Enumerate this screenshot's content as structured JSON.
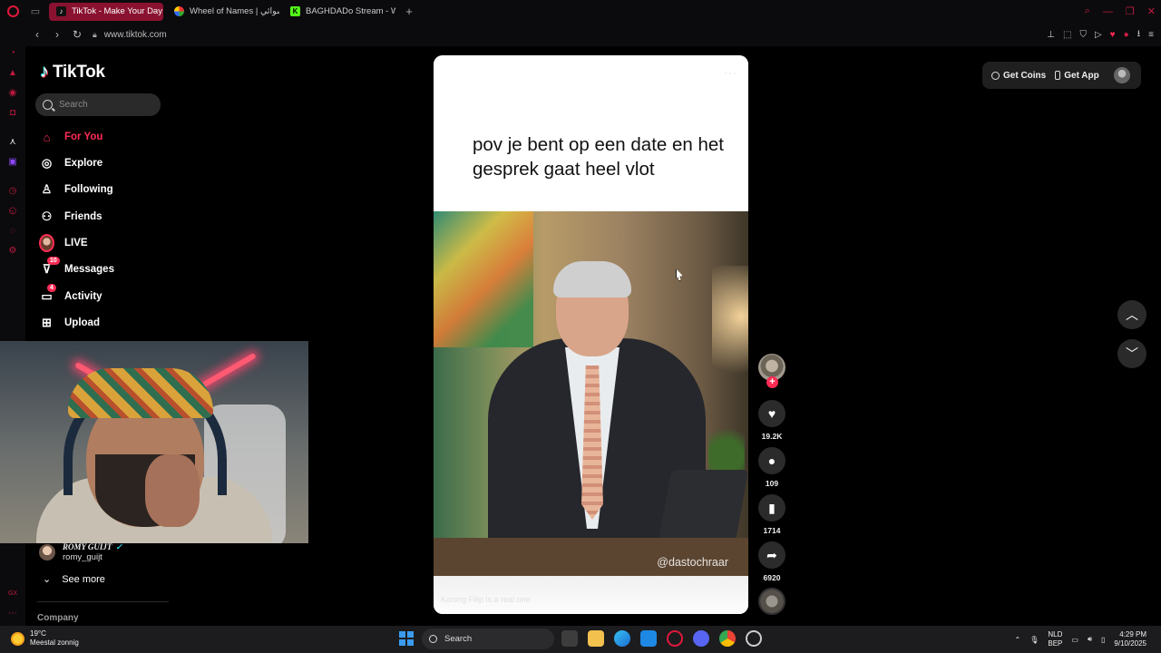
{
  "browser": {
    "tabs": [
      {
        "label": "TikTok - Make Your Day",
        "active": true,
        "icon": "tiktok-icon"
      },
      {
        "label": "Wheel of Names | عشوائي",
        "active": false,
        "icon": "wheel-icon"
      },
      {
        "label": "BAGHDADo Stream - Wat",
        "active": false,
        "icon": "kick-icon"
      }
    ],
    "url": "www.tiktok.com"
  },
  "tiktok": {
    "logo_text": "TikTok",
    "search_placeholder": "Search",
    "nav": [
      {
        "label": "For You",
        "icon": "home-icon",
        "active": true
      },
      {
        "label": "Explore",
        "icon": "compass-icon"
      },
      {
        "label": "Following",
        "icon": "following-icon"
      },
      {
        "label": "Friends",
        "icon": "friends-icon"
      },
      {
        "label": "LIVE",
        "icon": "live-avatar"
      },
      {
        "label": "Messages",
        "icon": "messages-icon",
        "badge": "10"
      },
      {
        "label": "Activity",
        "icon": "activity-icon",
        "badge": "4"
      },
      {
        "label": "Upload",
        "icon": "upload-icon"
      }
    ],
    "following_account": {
      "display_name": "ROMY GUIJT",
      "username": "romy_guijt"
    },
    "see_more": "See more",
    "company": "Company",
    "get_coins": "Get Coins",
    "get_app": "Get App"
  },
  "video": {
    "overlay_text": "pov je bent op een date en het gesprek gaat heel vlot",
    "watermark": "@dastochraar",
    "description": "Koning Filip is a real one",
    "likes": "19.2K",
    "comments": "109",
    "saves": "1714",
    "shares": "6920"
  },
  "taskbar": {
    "weather_temp": "19°C",
    "weather_desc": "Meestal zonnig",
    "search": "Search",
    "lang1": "NLD",
    "lang2": "BEP",
    "time": "4:29 PM",
    "date": "9/10/2025"
  },
  "colors": {
    "accent": "#fe2c55",
    "opera_red": "#c0193e"
  }
}
